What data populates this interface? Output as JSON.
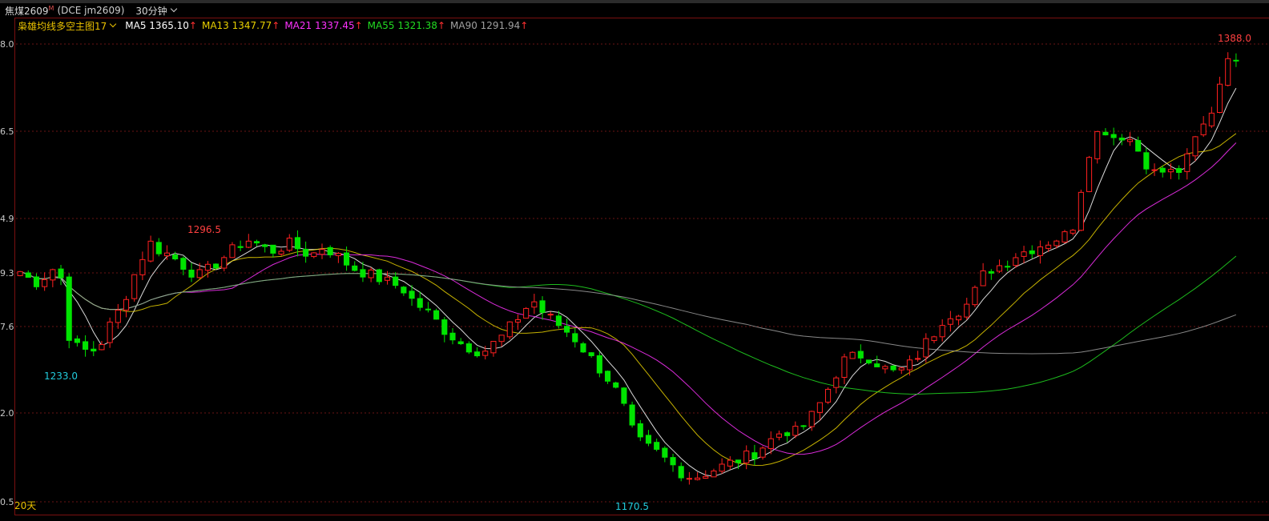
{
  "header": {
    "symbol": "焦煤2609",
    "superscript": "M",
    "code": "(DCE jm2609)",
    "period": "30分钟"
  },
  "legend": {
    "indicator": "枭雄均线多空主图17",
    "ma": [
      {
        "label": "MA5",
        "value": "1365.10",
        "arrow": "↑",
        "color": "#ffffff"
      },
      {
        "label": "MA13",
        "value": "1347.77",
        "arrow": "↑",
        "color": "#e8d000"
      },
      {
        "label": "MA21",
        "value": "1337.45",
        "arrow": "↑",
        "color": "#ff33ff"
      },
      {
        "label": "MA55",
        "value": "1321.38",
        "arrow": "↑",
        "color": "#22dd22"
      },
      {
        "label": "MA90",
        "value": "1291.94",
        "arrow": "↑",
        "color": "#a0a0a0"
      }
    ]
  },
  "bottom_label": "20天",
  "chart_data": {
    "type": "candlestick",
    "ylim": [
      1170.5,
      1388.0
    ],
    "y_ticks": [
      "8.0",
      "6.5",
      "4.9",
      "9.3",
      "7.6",
      "2.0",
      "0.5"
    ],
    "annotations": [
      {
        "label": "1388.0",
        "color": "#ff4040"
      },
      {
        "label": "1296.5",
        "color": "#ff4040"
      },
      {
        "label": "1233.0",
        "color": "#22ccdd"
      },
      {
        "label": "1170.5",
        "color": "#22ccdd"
      }
    ],
    "anchors": [
      1276,
      1272,
      1270,
      1278,
      1275,
      1240,
      1238,
      1236,
      1240,
      1250,
      1258,
      1270,
      1282,
      1290,
      1286,
      1284,
      1280,
      1276,
      1274,
      1278,
      1282,
      1286,
      1290,
      1292,
      1288,
      1286,
      1288,
      1290,
      1286,
      1284,
      1288,
      1286,
      1282,
      1278,
      1276,
      1274,
      1272,
      1270,
      1268,
      1262,
      1258,
      1254,
      1248,
      1244,
      1240,
      1238,
      1236,
      1240,
      1244,
      1250,
      1256,
      1262,
      1256,
      1252,
      1248,
      1244,
      1238,
      1232,
      1226,
      1220,
      1210,
      1196,
      1190,
      1188,
      1184,
      1180,
      1176,
      1174,
      1176,
      1178,
      1180,
      1182,
      1184,
      1186,
      1190,
      1194,
      1198,
      1196,
      1200,
      1206,
      1214,
      1224,
      1232,
      1234,
      1235,
      1232,
      1228,
      1226,
      1228,
      1232,
      1240,
      1246,
      1254,
      1256,
      1258,
      1266,
      1276,
      1278,
      1280,
      1284,
      1286,
      1288,
      1290,
      1292,
      1294,
      1300,
      1330,
      1344,
      1346,
      1342,
      1344,
      1338,
      1330,
      1324,
      1326,
      1324,
      1330,
      1342,
      1350,
      1360,
      1385,
      1378
    ]
  }
}
